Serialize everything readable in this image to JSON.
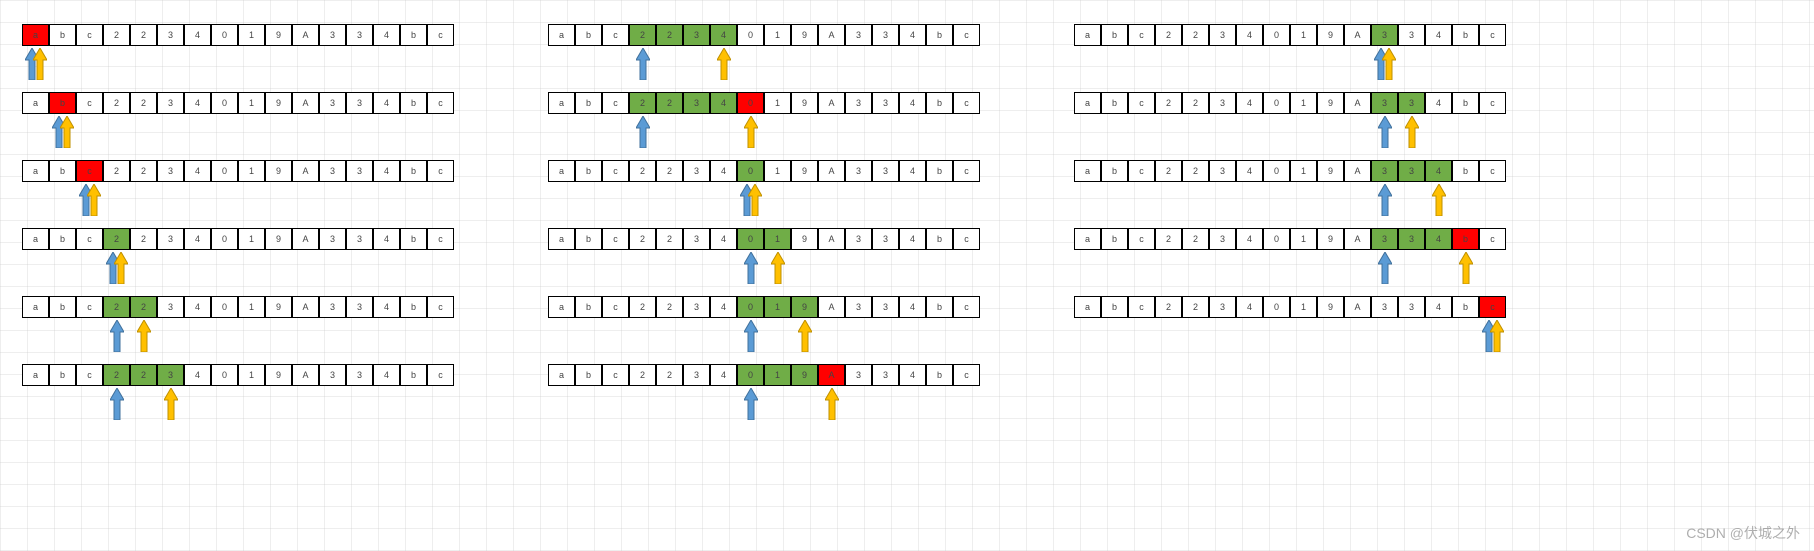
{
  "watermark": "CSDN @伏城之外",
  "sequence": [
    "a",
    "b",
    "c",
    "2",
    "2",
    "3",
    "4",
    "0",
    "1",
    "9",
    "A",
    "3",
    "3",
    "4",
    "b",
    "c"
  ],
  "colors": {
    "red": "#ff0000",
    "green": "#70ad47",
    "blue": "#5b9bd5",
    "yellow": "#ffc000"
  },
  "columns": [
    {
      "steps": [
        {
          "red": [
            0
          ],
          "green": [],
          "blueArrow": 0,
          "yellowArrow": 0
        },
        {
          "red": [
            1
          ],
          "green": [],
          "blueArrow": 1,
          "yellowArrow": 1
        },
        {
          "red": [
            2
          ],
          "green": [],
          "blueArrow": 2,
          "yellowArrow": 2
        },
        {
          "red": [],
          "green": [
            3
          ],
          "blueArrow": 3,
          "yellowArrow": 3
        },
        {
          "red": [],
          "green": [
            3,
            4
          ],
          "blueArrow": 3,
          "yellowArrow": 4
        },
        {
          "red": [],
          "green": [
            3,
            4,
            5
          ],
          "blueArrow": 3,
          "yellowArrow": 5
        }
      ]
    },
    {
      "steps": [
        {
          "red": [],
          "green": [
            3,
            4,
            5,
            6
          ],
          "blueArrow": 3,
          "yellowArrow": 6
        },
        {
          "red": [
            7
          ],
          "green": [
            3,
            4,
            5,
            6
          ],
          "blueArrow": 3,
          "yellowArrow": 7
        },
        {
          "red": [],
          "green": [
            7
          ],
          "blueArrow": 7,
          "yellowArrow": 7
        },
        {
          "red": [],
          "green": [
            7,
            8
          ],
          "blueArrow": 7,
          "yellowArrow": 8
        },
        {
          "red": [],
          "green": [
            7,
            8,
            9
          ],
          "blueArrow": 7,
          "yellowArrow": 9
        },
        {
          "red": [
            10
          ],
          "green": [
            7,
            8,
            9
          ],
          "blueArrow": 7,
          "yellowArrow": 10
        }
      ]
    },
    {
      "steps": [
        {
          "red": [],
          "green": [
            11
          ],
          "blueArrow": 11,
          "yellowArrow": 11
        },
        {
          "red": [],
          "green": [
            11,
            12
          ],
          "blueArrow": 11,
          "yellowArrow": 12
        },
        {
          "red": [],
          "green": [
            11,
            12,
            13
          ],
          "blueArrow": 11,
          "yellowArrow": 13
        },
        {
          "red": [
            14
          ],
          "green": [
            11,
            12,
            13
          ],
          "blueArrow": 11,
          "yellowArrow": 14
        },
        {
          "red": [
            15
          ],
          "green": [],
          "blueArrow": 15,
          "yellowArrow": 15
        }
      ]
    }
  ]
}
